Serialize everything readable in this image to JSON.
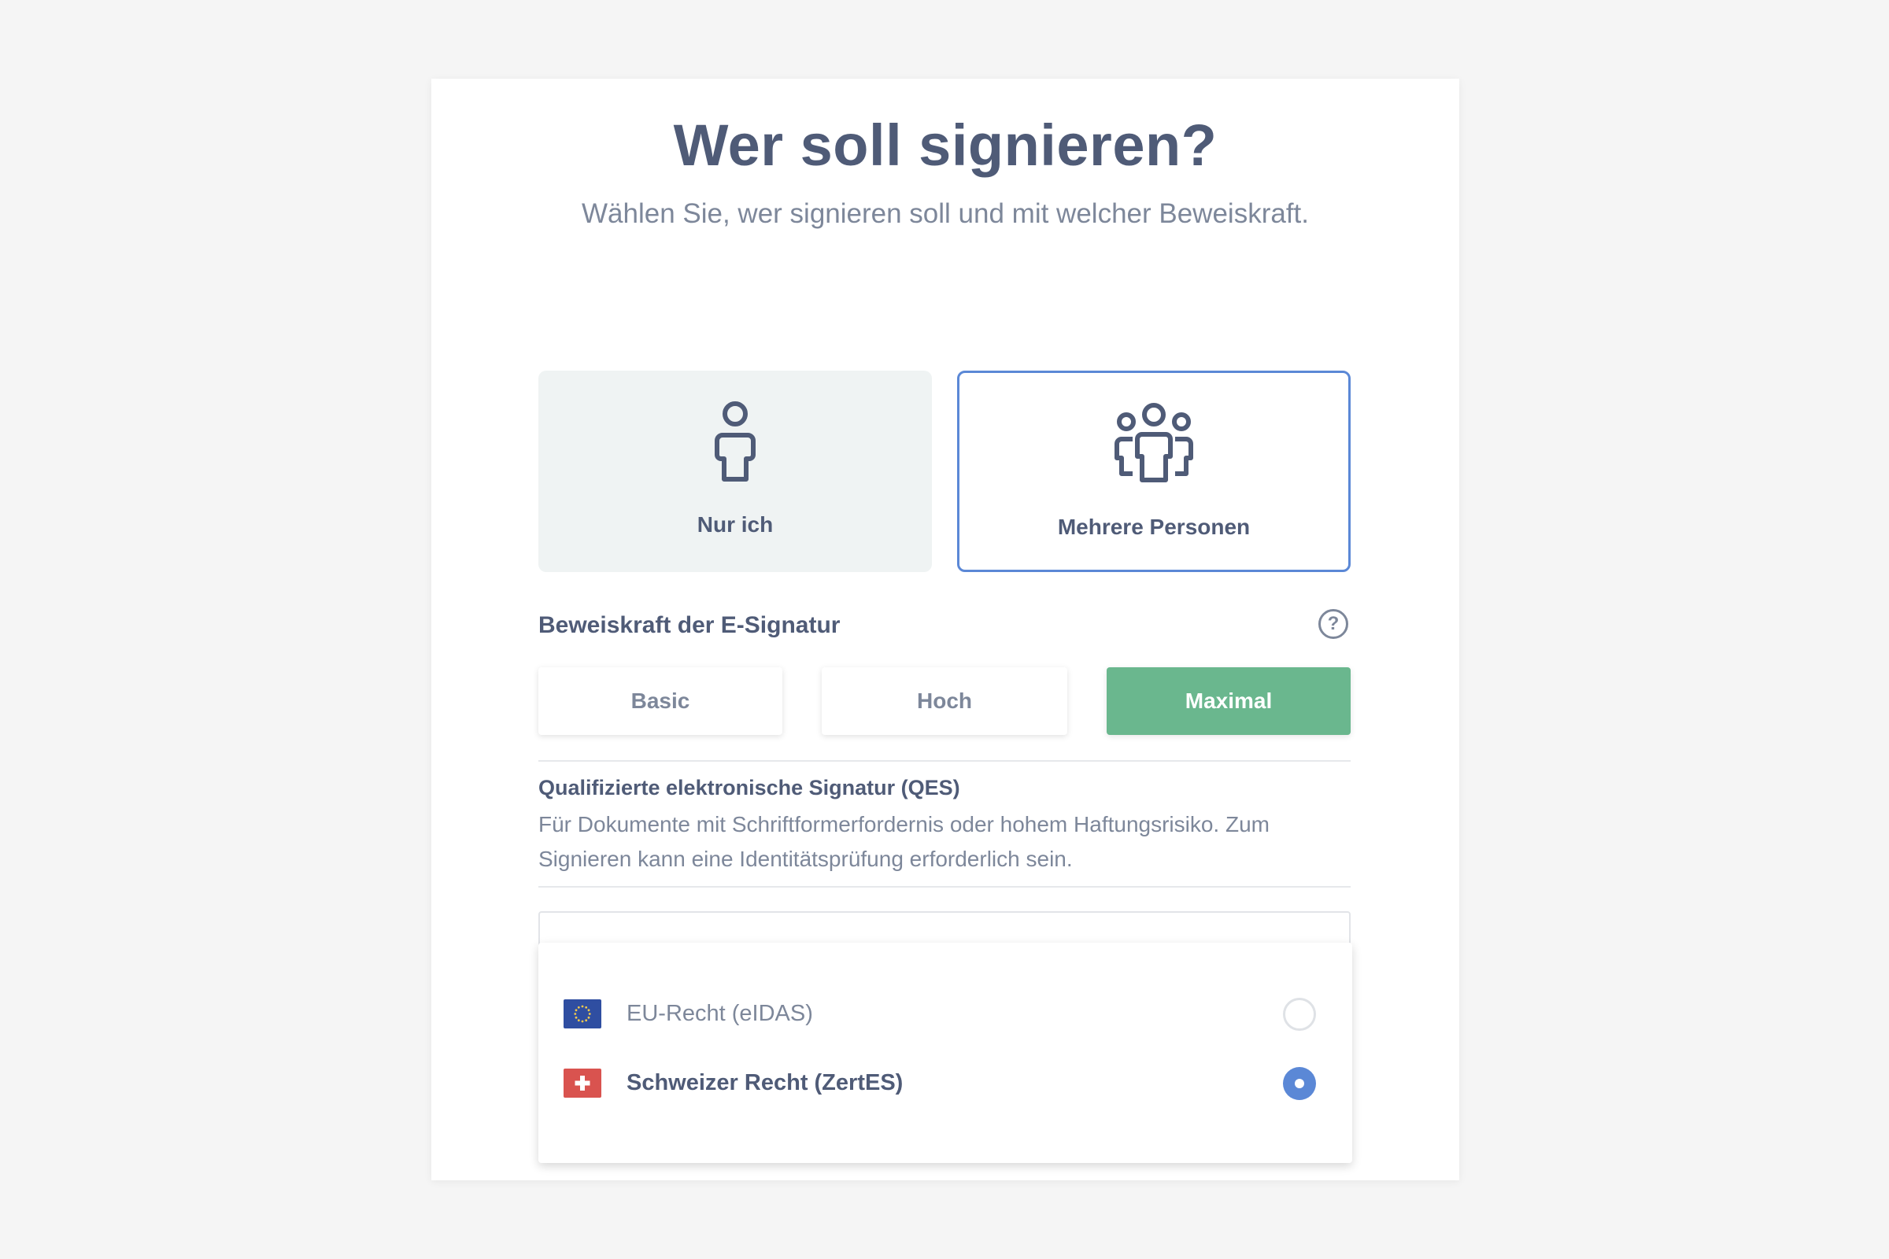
{
  "header": {
    "title": "Wer soll signieren?",
    "subtitle": "Wählen Sie, wer signieren soll und mit welcher Beweiskraft."
  },
  "signers": {
    "options": [
      {
        "label": "Nur ich",
        "icon": "person-icon",
        "selected": false
      },
      {
        "label": "Mehrere Personen",
        "icon": "group-icon",
        "selected": true
      }
    ]
  },
  "strength": {
    "title": "Beweiskraft der E-Signatur",
    "help_icon": "question-icon",
    "help_glyph": "?",
    "levels": [
      {
        "label": "Basic",
        "selected": false
      },
      {
        "label": "Hoch",
        "selected": false
      },
      {
        "label": "Maximal",
        "selected": true
      }
    ]
  },
  "qes": {
    "title": "Qualifizierte elektronische Signatur (QES)",
    "description": "Für Dokumente mit Schriftformerfordernis oder hohem Haftungsrisiko. Zum Signieren kann eine Identitätsprüfung erforderlich sein."
  },
  "jurisdiction": {
    "options": [
      {
        "label": "EU-Recht (eIDAS)",
        "flag": "eu-flag-icon",
        "selected": false
      },
      {
        "label": "Schweizer Recht (ZertES)",
        "flag": "swiss-flag-icon",
        "selected": true
      }
    ]
  },
  "colors": {
    "accent_blue": "#5b88d6",
    "accent_green": "#6ab78e",
    "text_dark": "#4f5b77",
    "text_muted": "#7d879a",
    "eu_blue": "#2f4ea1",
    "swiss_red": "#d9534f"
  }
}
